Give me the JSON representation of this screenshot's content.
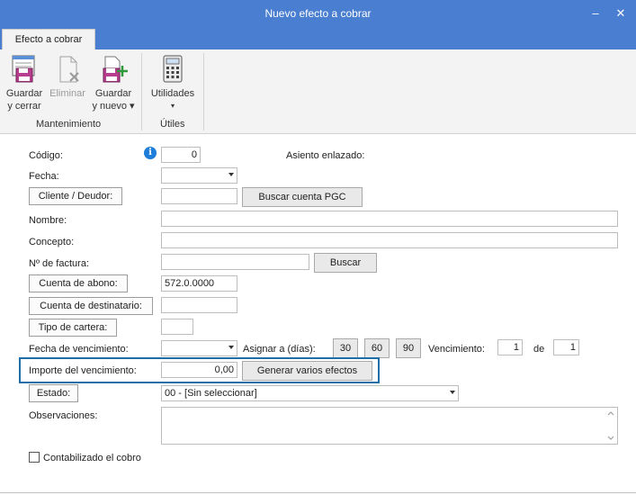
{
  "window": {
    "title": "Nuevo efecto a cobrar",
    "minimize_glyph": "–",
    "close_glyph": "✕"
  },
  "ribbon": {
    "tab_label": "Efecto a cobrar",
    "buttons": {
      "guardar_cerrar": [
        "Guardar",
        "y cerrar"
      ],
      "eliminar": "Eliminar",
      "guardar_nuevo": [
        "Guardar",
        "y nuevo ▾"
      ],
      "utilidades": [
        "Utilidades",
        "▾"
      ]
    },
    "groups": {
      "mantenimiento": "Mantenimiento",
      "utiles": "Útiles"
    }
  },
  "form": {
    "codigo": {
      "label": "Código:",
      "value": "0"
    },
    "asiento_enlazado": "Asiento enlazado:",
    "fecha": {
      "label": "Fecha:",
      "value": ""
    },
    "cliente": {
      "button": "Cliente / Deudor:",
      "value": "",
      "buscar_pgc": "Buscar cuenta PGC"
    },
    "nombre": {
      "label": "Nombre:",
      "value": ""
    },
    "concepto": {
      "label": "Concepto:",
      "value": ""
    },
    "factura": {
      "label": "Nº de factura:",
      "value": "",
      "buscar": "Buscar"
    },
    "cuenta_abono": {
      "button": "Cuenta de abono:",
      "value": "572.0.0000"
    },
    "cuenta_destinatario": {
      "button": "Cuenta de destinatario:",
      "value": ""
    },
    "tipo_cartera": {
      "button": "Tipo de cartera:",
      "value": ""
    },
    "vencimiento": {
      "label": "Fecha de vencimiento:",
      "value": "",
      "asignar": "Asignar a (días):",
      "dias": [
        "30",
        "60",
        "90"
      ],
      "vencimiento_label": "Vencimiento:",
      "vencimiento_value": "1",
      "de_label": "de",
      "de_value": "1"
    },
    "importe": {
      "label": "Importe del vencimiento:",
      "value": "0,00",
      "generar": "Generar varios efectos"
    },
    "estado": {
      "button": "Estado:",
      "value": "00 - [Sin seleccionar]"
    },
    "observaciones": {
      "label": "Observaciones:",
      "value": ""
    },
    "contabilizado": {
      "label": "Contabilizado el cobro",
      "checked": false
    }
  },
  "colors": {
    "titlebar": "#4a7ed0",
    "highlight": "#1e6fa8",
    "info": "#1e7dd8"
  }
}
